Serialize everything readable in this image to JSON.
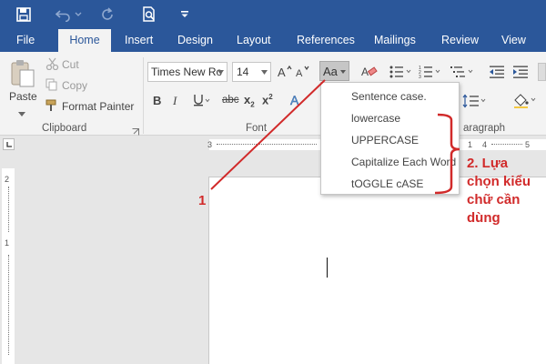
{
  "title_bar": {
    "icons": [
      "save-icon",
      "undo-icon",
      "redo-icon",
      "print-preview-icon",
      "customize-toolbar-icon"
    ]
  },
  "tabs": [
    "File",
    "Home",
    "Insert",
    "Design",
    "Layout",
    "References",
    "Mailings",
    "Review",
    "View"
  ],
  "active_tab": "Home",
  "clipboard": {
    "paste": "Paste",
    "cut": "Cut",
    "copy": "Copy",
    "format_painter": "Format Painter",
    "label": "Clipboard"
  },
  "font": {
    "font_name": "Times New Ro",
    "font_size": "14",
    "change_case": "Aa",
    "bold": "B",
    "italic": "I",
    "strikethrough": "abc",
    "subscript": "x",
    "subscript_sub": "2",
    "superscript": "x",
    "superscript_sup": "2",
    "label": "Font"
  },
  "paragraph": {
    "label": "aragraph"
  },
  "change_case_menu": {
    "items": [
      "Sentence case.",
      "lowercase",
      "UPPERCASE",
      "Capitalize Each Word",
      "tOGGLE cASE"
    ]
  },
  "ruler": {
    "h_ticks": [
      "3",
      "1",
      "4",
      "5"
    ],
    "v_ticks": [
      "2",
      "1"
    ]
  },
  "annotations": {
    "step1": "1",
    "step2_line1": "2. Lựa",
    "step2_line2": "chọn kiểu",
    "step2_line3": "chữ cần",
    "step2_line4": "dùng"
  },
  "colors": {
    "title_blue": "#2b579a",
    "ribbon_bg": "#f3f3f3",
    "annotation_red": "#d12a2a"
  }
}
